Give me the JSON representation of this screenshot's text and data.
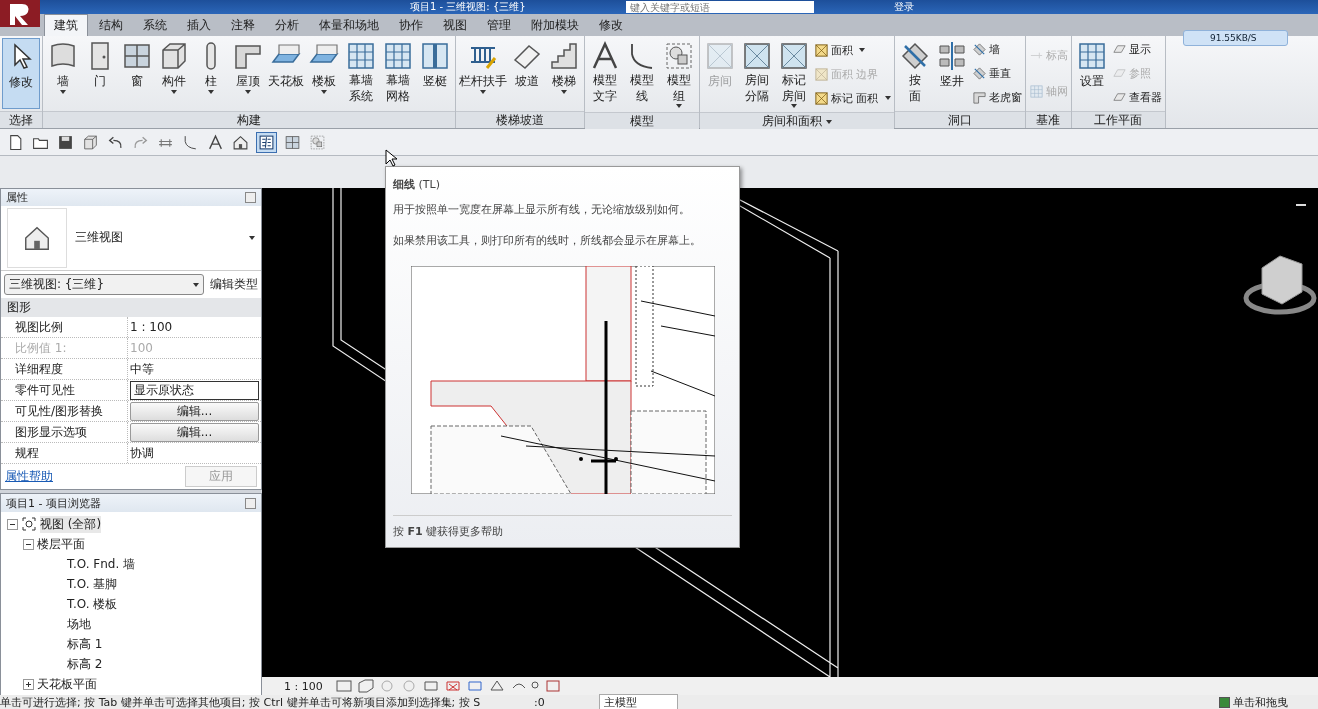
{
  "title_bar": {
    "title": "项目1 - 三维视图: {三维}",
    "search_placeholder": "键入关键字或短语",
    "sign_in": "登录"
  },
  "ribbon_tabs": [
    {
      "label": "建筑",
      "selected": true
    },
    {
      "label": "结构",
      "selected": false
    },
    {
      "label": "系统",
      "selected": false
    },
    {
      "label": "插入",
      "selected": false
    },
    {
      "label": "注释",
      "selected": false
    },
    {
      "label": "分析",
      "selected": false
    },
    {
      "label": "体量和场地",
      "selected": false
    },
    {
      "label": "协作",
      "selected": false
    },
    {
      "label": "视图",
      "selected": false
    },
    {
      "label": "管理",
      "selected": false
    },
    {
      "label": "附加模块",
      "selected": false
    },
    {
      "label": "修改",
      "selected": false
    }
  ],
  "ribbon_panels": [
    {
      "title": "选择",
      "dropdown": false,
      "large_tools": [
        {
          "label": "修改",
          "kind": "cursor",
          "multiline": false,
          "selected": true,
          "disabled": false,
          "dropdown": false
        }
      ]
    },
    {
      "title": "构建",
      "dropdown": false,
      "large_tools": [
        {
          "label": "墙",
          "kind": "wall",
          "multiline": false,
          "selected": false,
          "disabled": false,
          "dropdown": true
        },
        {
          "label": "门",
          "kind": "door",
          "multiline": false,
          "selected": false,
          "disabled": false,
          "dropdown": false
        },
        {
          "label": "窗",
          "kind": "window",
          "multiline": false,
          "selected": false,
          "disabled": false,
          "dropdown": false
        },
        {
          "label": "构件",
          "kind": "box",
          "multiline": false,
          "selected": false,
          "disabled": false,
          "dropdown": true
        },
        {
          "label": "柱",
          "kind": "column",
          "multiline": false,
          "selected": false,
          "disabled": false,
          "dropdown": true
        },
        {
          "label": "屋顶",
          "kind": "roof",
          "multiline": false,
          "selected": false,
          "disabled": false,
          "dropdown": true
        },
        {
          "label": "天花板",
          "kind": "slab",
          "multiline": false,
          "selected": false,
          "disabled": false,
          "dropdown": false
        },
        {
          "label": "楼板",
          "kind": "slab",
          "multiline": false,
          "selected": false,
          "disabled": false,
          "dropdown": true
        },
        {
          "label": "幕墙系统",
          "kind": "grid",
          "multiline": true,
          "selected": false,
          "disabled": false,
          "dropdown": false
        },
        {
          "label": "幕墙网格",
          "kind": "grid",
          "multiline": true,
          "selected": false,
          "disabled": false,
          "dropdown": false
        },
        {
          "label": "竖梃",
          "kind": "mullion",
          "multiline": false,
          "selected": false,
          "disabled": false,
          "dropdown": false
        }
      ]
    },
    {
      "title": "楼梯坡道",
      "dropdown": false,
      "large_tools": [
        {
          "label": "栏杆扶手",
          "kind": "railing",
          "multiline": false,
          "selected": false,
          "disabled": false,
          "dropdown": true
        },
        {
          "label": "坡道",
          "kind": "ramp",
          "multiline": false,
          "selected": false,
          "disabled": false,
          "dropdown": false
        },
        {
          "label": "楼梯",
          "kind": "stair",
          "multiline": false,
          "selected": false,
          "disabled": false,
          "dropdown": true
        }
      ]
    },
    {
      "title": "模型",
      "dropdown": false,
      "large_tools": [
        {
          "label": "模型文字",
          "kind": "text",
          "multiline": true,
          "selected": false,
          "disabled": false,
          "dropdown": false
        },
        {
          "label": "模型线",
          "kind": "line",
          "multiline": true,
          "selected": false,
          "disabled": false,
          "dropdown": false
        },
        {
          "label": "模型组",
          "kind": "group",
          "multiline": true,
          "selected": false,
          "disabled": false,
          "dropdown": true
        }
      ]
    },
    {
      "title": "房间和面积",
      "dropdown": true,
      "large_tools": [
        {
          "label": "房间",
          "kind": "room",
          "multiline": false,
          "selected": false,
          "disabled": true,
          "dropdown": false
        },
        {
          "label": "房间分隔",
          "kind": "room",
          "multiline": true,
          "selected": false,
          "disabled": false,
          "dropdown": false
        },
        {
          "label": "标记房间",
          "kind": "room",
          "multiline": true,
          "selected": false,
          "disabled": false,
          "dropdown": true
        }
      ],
      "small_tools": [
        {
          "label": "面积",
          "kind": "area",
          "disabled": false,
          "dropdown": true
        },
        {
          "label": "面积 边界",
          "kind": "area",
          "disabled": true,
          "dropdown": false
        },
        {
          "label": "标记 面积",
          "kind": "area",
          "disabled": false,
          "dropdown": true
        }
      ]
    },
    {
      "title": "洞口",
      "dropdown": false,
      "large_tools": [
        {
          "label": "按面",
          "kind": "opening",
          "multiline": true,
          "selected": false,
          "disabled": false,
          "dropdown": false
        },
        {
          "label": "竖井",
          "kind": "shaft",
          "multiline": false,
          "selected": false,
          "disabled": false,
          "dropdown": false
        }
      ],
      "small_tools": [
        {
          "label": "墙",
          "kind": "opening",
          "disabled": false,
          "dropdown": false
        },
        {
          "label": "垂直",
          "kind": "opening",
          "disabled": false,
          "dropdown": false
        },
        {
          "label": "老虎窗",
          "kind": "roof",
          "disabled": false,
          "dropdown": false
        }
      ]
    },
    {
      "title": "基准",
      "dropdown": false,
      "small_tools": [
        {
          "label": "标高",
          "kind": "level",
          "disabled": true,
          "dropdown": false
        },
        {
          "label": "轴网",
          "kind": "grid",
          "disabled": true,
          "dropdown": false
        }
      ]
    },
    {
      "title": "工作平面",
      "dropdown": false,
      "large_tools": [
        {
          "label": "设置",
          "kind": "grid",
          "multiline": false,
          "selected": false,
          "disabled": false,
          "dropdown": false
        }
      ],
      "small_tools": [
        {
          "label": "显示",
          "kind": "plane",
          "disabled": false,
          "dropdown": false
        },
        {
          "label": "参照",
          "kind": "plane",
          "disabled": true,
          "dropdown": false
        },
        {
          "label": "查看器",
          "kind": "plane",
          "disabled": false,
          "dropdown": false
        }
      ]
    }
  ],
  "net_speed": "91.55KB/S",
  "quick_access": [
    {
      "kind": "document",
      "selected": false
    },
    {
      "kind": "folder",
      "selected": false
    },
    {
      "kind": "disk",
      "selected": false
    },
    {
      "kind": "box",
      "selected": false
    },
    {
      "kind": "undo",
      "selected": false
    },
    {
      "kind": "redo",
      "selected": false
    },
    {
      "kind": "dimension",
      "selected": false
    },
    {
      "kind": "line",
      "selected": false
    },
    {
      "kind": "text",
      "selected": false
    },
    {
      "kind": "house",
      "selected": false
    },
    {
      "kind": "thin-lines",
      "selected": true
    },
    {
      "kind": "window",
      "selected": false
    },
    {
      "kind": "group",
      "selected": false
    }
  ],
  "properties": {
    "title": "属性",
    "type_name": "三维视图",
    "selector": "三维视图: {三维}",
    "edit_type": "编辑类型",
    "group": "图形",
    "rows": [
      {
        "name": "视图比例",
        "value": "1 : 100",
        "kind": "text"
      },
      {
        "name": "比例值 1:",
        "value": "100",
        "kind": "disabled"
      },
      {
        "name": "详细程度",
        "value": "中等",
        "kind": "text"
      },
      {
        "name": "零件可见性",
        "value": "显示原状态",
        "kind": "field"
      },
      {
        "name": "可见性/图形替换",
        "value": "编辑...",
        "kind": "button"
      },
      {
        "name": "图形显示选项",
        "value": "编辑...",
        "kind": "button"
      },
      {
        "name": "规程",
        "value": "协调",
        "kind": "text"
      }
    ],
    "help": "属性帮助",
    "apply": "应用"
  },
  "browser": {
    "title": "项目1 - 项目浏览器",
    "tree": [
      {
        "label": "视图 (全部)",
        "selected": true,
        "expanded": true,
        "children": [
          {
            "label": "楼层平面",
            "selected": false,
            "expanded": true,
            "children": [
              {
                "label": "T.O. Fnd. 墙",
                "selected": false
              },
              {
                "label": "T.O. 基脚",
                "selected": false
              },
              {
                "label": "T.O. 楼板",
                "selected": false
              },
              {
                "label": "场地",
                "selected": false
              },
              {
                "label": "标高 1",
                "selected": false
              },
              {
                "label": "标高 2",
                "selected": false
              }
            ]
          },
          {
            "label": "天花板平面",
            "selected": false,
            "expanded": false
          }
        ]
      }
    ]
  },
  "tooltip": {
    "title": "细线",
    "shortcut": "(TL)",
    "lines": [
      "用于按照单一宽度在屏幕上显示所有线，无论缩放级别如何。",
      "如果禁用该工具，则打印所有的线时，所线都会显示在屏幕上。"
    ],
    "footer": "按 **F1** 键获得更多帮助"
  },
  "view_bar": {
    "scale": "1 : 100"
  },
  "status_bar": {
    "message": "单击可进行选择; 按 Tab 键并单击可选择其他项目; 按 Ctrl 键并单击可将新项目添加到选择集; 按 S",
    "count": ":0",
    "model": "主模型",
    "drag_label": "单击和拖曳",
    "drag_checked": true
  }
}
